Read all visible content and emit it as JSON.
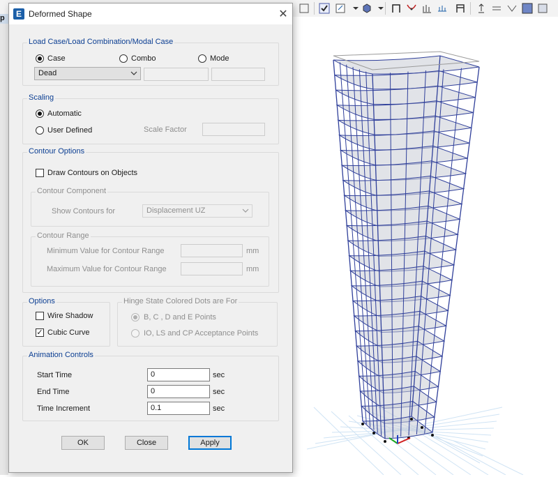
{
  "window": {
    "title": "Deformed Shape",
    "app_icon_letter": "E"
  },
  "app": {
    "side_tab": "p"
  },
  "load_case": {
    "group_label": "Load Case/Load Combination/Modal Case",
    "options": [
      "Case",
      "Combo",
      "Mode"
    ],
    "selected_option": "Case",
    "case_value": "Dead",
    "combo_value": "",
    "mode_value": ""
  },
  "scaling": {
    "group_label": "Scaling",
    "automatic_label": "Automatic",
    "user_defined_label": "User Defined",
    "selected": "Automatic",
    "scale_factor_label": "Scale Factor",
    "scale_factor_value": ""
  },
  "contour": {
    "group_label": "Contour Options",
    "draw_label": "Draw Contours on Objects",
    "draw_checked": false,
    "component_group_label": "Contour Component",
    "show_label": "Show Contours for",
    "show_value": "Displacement UZ",
    "range_group_label": "Contour Range",
    "min_label": "Minimum Value for Contour Range",
    "max_label": "Maximum Value for Contour Range",
    "min_value": "",
    "max_value": "",
    "unit": "mm"
  },
  "options": {
    "group_label": "Options",
    "wire_shadow_label": "Wire Shadow",
    "wire_shadow_checked": false,
    "cubic_curve_label": "Cubic Curve",
    "cubic_curve_checked": true
  },
  "hinge": {
    "group_label": "Hinge State Colored Dots are For",
    "option1": "B, C , D and E Points",
    "option2": "IO, LS and CP Acceptance Points",
    "selected": "B, C , D and E Points"
  },
  "animation": {
    "group_label": "Animation Controls",
    "start_label": "Start Time",
    "start_value": "0",
    "end_label": "End Time",
    "end_value": "0",
    "increment_label": "Time Increment",
    "increment_value": "0.1",
    "unit": "sec"
  },
  "buttons": {
    "ok": "OK",
    "close": "Close",
    "apply": "Apply"
  },
  "viewport": {
    "model": "3D tall building frame, deformed shape",
    "frame_color": "#2f3f9a",
    "slab_color": "#c9ccd6"
  }
}
